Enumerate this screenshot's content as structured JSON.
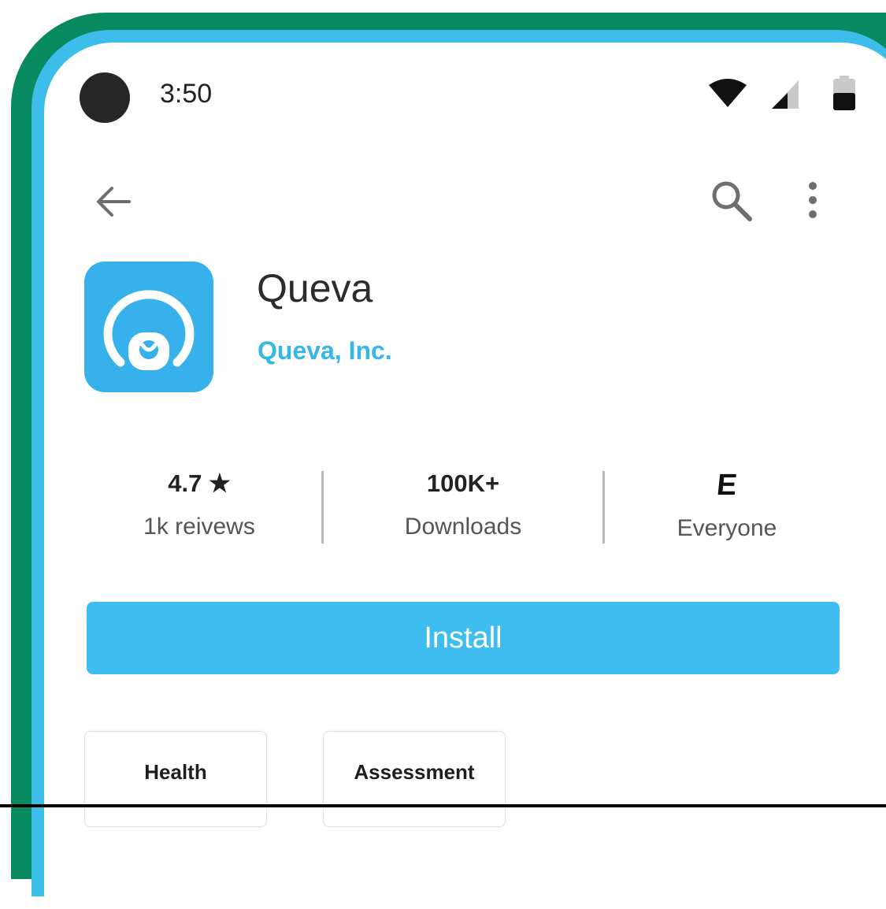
{
  "status_bar": {
    "time": "3:50"
  },
  "app": {
    "name": "Queva",
    "developer": "Queva, Inc.",
    "icon": "queva-app-icon",
    "icon_color": "#36b1ec"
  },
  "stats": {
    "rating": {
      "value": "4.7",
      "star": "★",
      "label": "1k reivews"
    },
    "downloads": {
      "value": "100K+",
      "label": "Downloads"
    },
    "content_rating": {
      "badge": "E",
      "label": "Everyone"
    }
  },
  "install_button": {
    "label": "Install",
    "color": "#3dbdf0"
  },
  "chips": [
    {
      "label": "Health"
    },
    {
      "label": "Assessment"
    }
  ],
  "colors": {
    "frame_green": "#078a60",
    "frame_blue": "#3dbde9",
    "accent": "#35b7ea"
  }
}
